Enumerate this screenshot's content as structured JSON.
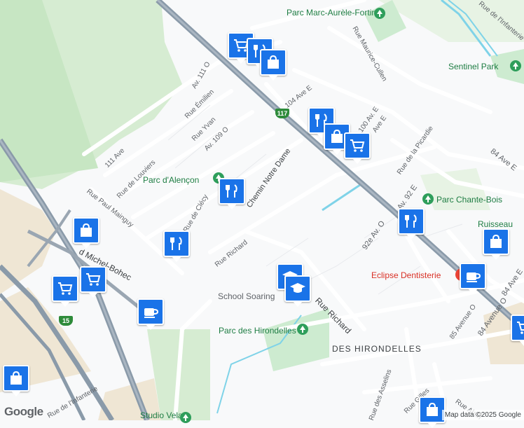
{
  "map": {
    "attribution": "Map data ©2025 Google",
    "logo": "Google",
    "route_shields": [
      "117",
      "15"
    ],
    "parks": {
      "marc_aurele": "Parc Marc-Aurèle-Fortin",
      "sentinel": "Sentinel Park",
      "alencon": "Parc d'Alençon",
      "chante_bois": "Parc Chante-Bois",
      "hirondelles": "Parc des Hirondelles",
      "studio_vela": "Studio Vela"
    },
    "poi": {
      "eclipse": "Eclipse Dentisterie",
      "ruisseau": "Ruisseau",
      "school": "School Soaring",
      "area": "DES HIRONDELLES"
    },
    "streets": {
      "chemin": "Chemin Notre Dame",
      "rue_richard_main": "Rue Richard",
      "rue_richard_2": "Rue Richard",
      "rue_infanterie": "Rue de l'Infanterie",
      "rue_maurice": "Rue Maurice-Cullen",
      "ave104": "104 Ave E",
      "ave100": "100 Av. E",
      "ave_e": "Ave E",
      "rue_picardie": "Rue de la Picardie",
      "ave84e": "84 Ave E",
      "av92e": "Av. 92 E",
      "av92o": "92e Av. O",
      "ave85": "85 Avenue O",
      "ave84o": "84 Avenue O",
      "ave84e2": "84 Ave E",
      "rue_gilles": "Rue Gilles",
      "rue_alain": "Rue Alain",
      "rue_asselins": "Rue des Asselins",
      "av111o": "Av. 111 O",
      "rue_emilien": "Rue Émilien",
      "rue_yvan": "Rue Yvan",
      "av109o": "Av. 109 O",
      "ave111": "111 Ave",
      "rue_louviers": "Rue de Louviers",
      "rue_paul": "Rue Paul Mainguy",
      "rue_clecy": "Rue de Clécy",
      "bohec": "d Michel-Bohec",
      "rue_infanterie2": "Rue de l'Infanterie"
    }
  },
  "markers": [
    {
      "icon": "cart"
    },
    {
      "icon": "restaurant"
    },
    {
      "icon": "shopping-bag"
    },
    {
      "icon": "restaurant"
    },
    {
      "icon": "shopping-bag"
    },
    {
      "icon": "cart"
    },
    {
      "icon": "restaurant"
    },
    {
      "icon": "shopping-bag"
    },
    {
      "icon": "restaurant"
    },
    {
      "icon": "shopping-bag"
    },
    {
      "icon": "cart"
    },
    {
      "icon": "cart"
    },
    {
      "icon": "cart"
    },
    {
      "icon": "coffee"
    },
    {
      "icon": "school"
    },
    {
      "icon": "school"
    },
    {
      "icon": "coffee"
    },
    {
      "icon": "shopping-bag"
    },
    {
      "icon": "cart"
    },
    {
      "icon": "shopping-bag"
    }
  ],
  "colors": {
    "marker": "#1a73e8",
    "park_green": "#2e9e5b",
    "highway": "#8a9aa9",
    "park_fill": "#cdebd0",
    "water": "#7fd3e8"
  }
}
